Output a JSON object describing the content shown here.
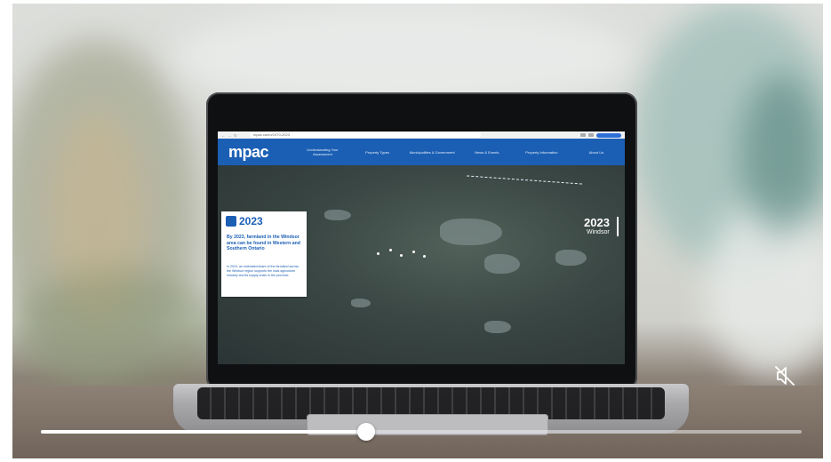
{
  "video": {
    "progress_fraction": 0.428,
    "mute_icon": "speaker-muted-icon"
  },
  "browser": {
    "url": "mpac.ca/en/1970-2023"
  },
  "site": {
    "logo_text": "mpac",
    "nav_items": [
      "Understanding Your Assessment",
      "Property Types",
      "Municipalities & Government",
      "News & Events",
      "Property Information",
      "About Us"
    ]
  },
  "timeline_card": {
    "year": "2023",
    "headline": "By 2023, farmland in the Windsor area can be found in Western and Southern Ontario",
    "body": "In 2023, an estimated share of the farmland across the Windsor region supports the local agriculture industry and its supply chain in the province."
  },
  "map_label": {
    "year": "2023",
    "city": "Windsor"
  },
  "colors": {
    "brand_blue": "#1b5fb4",
    "white": "#ffffff"
  }
}
